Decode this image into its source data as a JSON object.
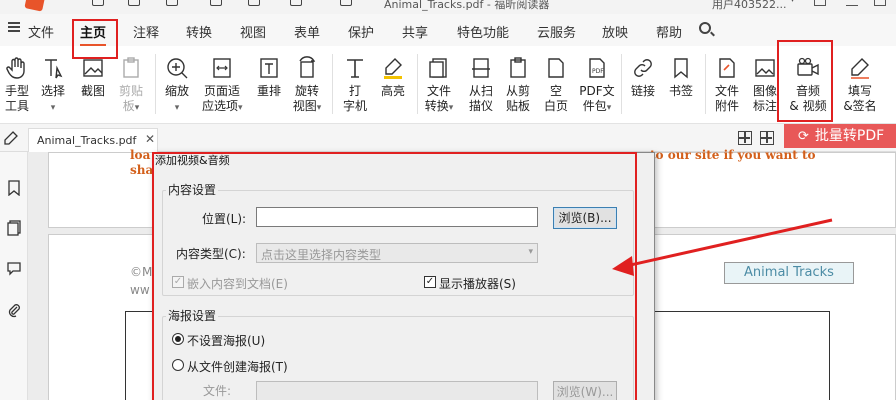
{
  "title_bar": {
    "title": "Animal_Tracks.pdf - 福昕阅读器",
    "user": "用户403522..."
  },
  "menu": {
    "hamburger_label": "文件",
    "items": [
      "主页",
      "注释",
      "转换",
      "视图",
      "表单",
      "保护",
      "共享",
      "特色功能",
      "云服务",
      "放映",
      "帮助"
    ],
    "active": "主页"
  },
  "toolbar": {
    "tools": [
      {
        "l1": "手型",
        "l2": "工具",
        "icon": "hand-icon"
      },
      {
        "l1": "选择",
        "l2": "",
        "icon": "select-cursor-icon",
        "caret": true
      },
      {
        "l1": "截图",
        "l2": "",
        "icon": "screenshot-icon"
      },
      {
        "l1": "剪贴",
        "l2": "板",
        "icon": "clipboard-icon",
        "caret": true,
        "disabled": true
      },
      {
        "l1": "缩放",
        "l2": "",
        "icon": "zoom-icon",
        "caret": true
      },
      {
        "l1": "页面适",
        "l2": "应选项",
        "icon": "fit-page-icon",
        "caret": true
      },
      {
        "l1": "重排",
        "l2": "",
        "icon": "reflow-icon"
      },
      {
        "l1": "旋转",
        "l2": "视图",
        "icon": "rotate-icon",
        "caret": true
      },
      {
        "l1": "打",
        "l2": "字机",
        "icon": "typewriter-icon"
      },
      {
        "l1": "高亮",
        "l2": "",
        "icon": "highlight-icon"
      },
      {
        "l1": "文件",
        "l2": "转换",
        "icon": "file-convert-icon",
        "caret": true
      },
      {
        "l1": "从扫",
        "l2": "描仪",
        "icon": "scanner-icon"
      },
      {
        "l1": "从剪",
        "l2": "贴板",
        "icon": "from-clipboard-icon"
      },
      {
        "l1": "空",
        "l2": "白页",
        "icon": "blank-page-icon"
      },
      {
        "l1": "PDF文",
        "l2": "件包",
        "icon": "pdf-portfolio-icon",
        "caret": true
      },
      {
        "l1": "链接",
        "l2": "",
        "icon": "link-icon"
      },
      {
        "l1": "书签",
        "l2": "",
        "icon": "bookmark-icon"
      },
      {
        "l1": "文件",
        "l2": "附件",
        "icon": "attachment-icon"
      },
      {
        "l1": "图像",
        "l2": "标注",
        "icon": "image-annotation-icon"
      },
      {
        "l1": "音频",
        "l2": "& 视频",
        "icon": "video-camera-icon"
      },
      {
        "l1": "填写",
        "l2": "&签名",
        "icon": "fill-sign-icon"
      }
    ]
  },
  "tabs": {
    "doc_tab": "Animal_Tracks.pdf",
    "batch_label": "批量转PDF"
  },
  "document": {
    "line1_left": "loa",
    "line1_right": "to our site if you want to",
    "line2_left": "sha",
    "copyright": "©M",
    "www": "ww",
    "animal_tracks": "Animal Tracks"
  },
  "dialog": {
    "title": "添加视频&音频",
    "content_group": "内容设置",
    "location_label": "位置(L):",
    "location_value": "",
    "browse_label": "浏览(B)...",
    "content_type_label": "内容类型(C):",
    "content_type_placeholder": "点击这里选择内容类型",
    "embed_label": "嵌入内容到文档(E)",
    "show_player_label": "显示播放器(S)",
    "poster_group": "海报设置",
    "no_poster_label": "不设置海报(U)",
    "from_file_label": "从文件创建海报(T)",
    "file_label": "文件:",
    "file_browse_label": "浏览(W)..."
  },
  "colors": {
    "annotation_red": "#e02020",
    "accent_orange": "#e8542a",
    "batch_red": "#e85858"
  }
}
